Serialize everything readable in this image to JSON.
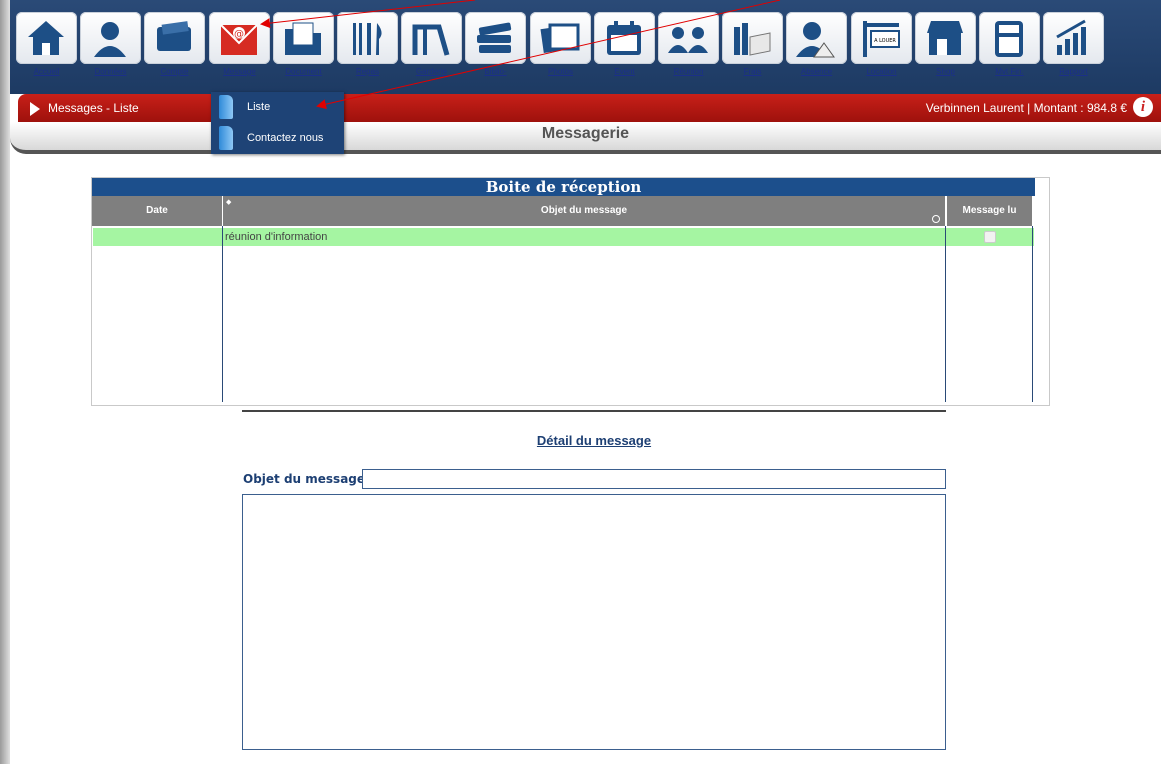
{
  "nav": {
    "items": [
      {
        "label": "Accueil",
        "icon": "home-icon"
      },
      {
        "label": "Données",
        "icon": "user-icon"
      },
      {
        "label": "Compte",
        "icon": "wallet-icon"
      },
      {
        "label": "Message",
        "icon": "mail-icon"
      },
      {
        "label": "Document",
        "icon": "folder-icon"
      },
      {
        "label": "Repas",
        "icon": "cutlery-icon"
      },
      {
        "label": "Garderie",
        "icon": "playground-icon"
      },
      {
        "label": "Biblio-",
        "icon": "books-icon"
      },
      {
        "label": "Photos",
        "icon": "photos-icon"
      },
      {
        "label": "Event",
        "icon": "calendar-icon"
      },
      {
        "label": "Réunion",
        "icon": "meeting-icon"
      },
      {
        "label": "Frais",
        "icon": "expenses-icon"
      },
      {
        "label": "Absence",
        "icon": "absence-icon"
      },
      {
        "label": "Location",
        "icon": "for-rent-sign-icon",
        "sign_text": "A LOUER"
      },
      {
        "label": "Shop",
        "icon": "shop-icon"
      },
      {
        "label": "Mvt Fin.",
        "icon": "calculator-icon"
      },
      {
        "label": "Rapport",
        "icon": "chart-icon"
      }
    ]
  },
  "breadcrumb": "Messages - Liste",
  "user_info": "Verbinnen Laurent | Montant : 984.8 €",
  "page_title": "Messagerie",
  "dropdown": {
    "items": [
      {
        "label": "Liste"
      },
      {
        "label": "Contactez nous"
      }
    ]
  },
  "inbox": {
    "title": "Boite de réception",
    "columns": [
      "Date",
      "Objet du message",
      "Message lu"
    ],
    "rows": [
      {
        "date": "",
        "subject": "réunion d'information",
        "read": false
      }
    ]
  },
  "detail": {
    "title": "Détail du message",
    "subject_label": "Objet du message",
    "subject_value": "",
    "body_value": ""
  },
  "colors": {
    "nav_bg": "#1d3a63",
    "red_bar": "#b3160f",
    "table_header": "#1c4f8c",
    "row_highlight": "#a5f5a2",
    "annotation_arrow": "#e00000"
  }
}
